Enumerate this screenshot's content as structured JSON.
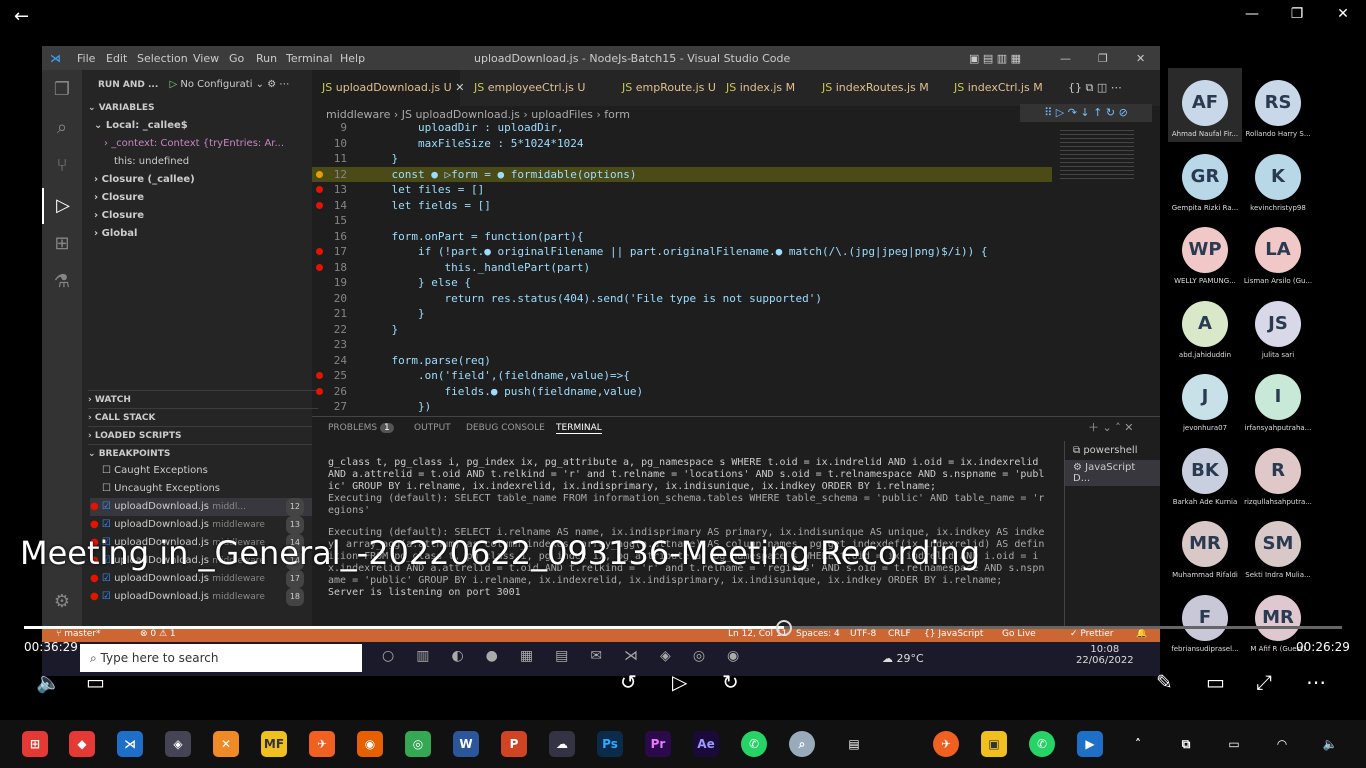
{
  "window": {
    "title": "uploadDownload.js - NodeJs-Batch15 - Visual Studio Code",
    "menus": [
      "File",
      "Edit",
      "Selection",
      "View",
      "Go",
      "Run",
      "Terminal",
      "Help"
    ]
  },
  "sidebar": {
    "run_label": "RUN AND ...",
    "config": "No Configurati",
    "variables": "VARIABLES",
    "local": "Local: _callee$",
    "context": "_context: Context {tryEntries: Ar...",
    "this": "this: undefined",
    "closure1": "Closure (_callee)",
    "closure2": "Closure",
    "closure3": "Closure",
    "global": "Global",
    "watch": "WATCH",
    "callstack": "CALL STACK",
    "loaded": "LOADED SCRIPTS",
    "breakpoints": "BREAKPOINTS",
    "caught": "Caught Exceptions",
    "uncaught": "Uncaught Exceptions",
    "bps": [
      {
        "file": "uploadDownload.js",
        "dir": "middl...",
        "line": "12"
      },
      {
        "file": "uploadDownload.js",
        "dir": "middleware",
        "line": "13"
      },
      {
        "file": "uploadDownload.js",
        "dir": "middleware",
        "line": "14"
      },
      {
        "file": "uploadDownload.js",
        "dir": "middleware",
        "line": "14"
      },
      {
        "file": "uploadDownload.js",
        "dir": "middleware",
        "line": "17"
      },
      {
        "file": "uploadDownload.js",
        "dir": "middleware",
        "line": "18"
      }
    ]
  },
  "tabs": [
    {
      "name": "uploadDownload.js",
      "mark": "U"
    },
    {
      "name": "employeeCtrl.js",
      "mark": "U"
    },
    {
      "name": "empRoute.js",
      "mark": "U"
    },
    {
      "name": "index.js",
      "mark": "M"
    },
    {
      "name": "indexRoutes.js",
      "mark": "M"
    },
    {
      "name": "indexCtrl.js",
      "mark": "M"
    }
  ],
  "crumbs": "middleware  ›  JS uploadDownload.js  ›  uploadFiles  ›  form",
  "code": [
    {
      "n": "9",
      "t": "        uploadDir : uploadDir,"
    },
    {
      "n": "10",
      "t": "        maxFileSize : 5*1024*1024"
    },
    {
      "n": "11",
      "t": "    }"
    },
    {
      "n": "12",
      "t": "    const ● ▷form = ● formidable(options)"
    },
    {
      "n": "13",
      "t": "    let files = []"
    },
    {
      "n": "14",
      "t": "    let fields = []"
    },
    {
      "n": "15",
      "t": ""
    },
    {
      "n": "16",
      "t": "    form.onPart = function(part){"
    },
    {
      "n": "17",
      "t": "        if (!part.● originalFilename || part.originalFilename.● match(/\\.(jpg|jpeg|png)$/i)) {"
    },
    {
      "n": "18",
      "t": "            this._handlePart(part)"
    },
    {
      "n": "19",
      "t": "        } else {"
    },
    {
      "n": "20",
      "t": "            return res.status(404).send('File type is not supported')"
    },
    {
      "n": "21",
      "t": "        }"
    },
    {
      "n": "22",
      "t": "    }"
    },
    {
      "n": "23",
      "t": ""
    },
    {
      "n": "24",
      "t": "    form.parse(req)"
    },
    {
      "n": "25",
      "t": "        .on('field',(fieldname,value)=>{"
    },
    {
      "n": "26",
      "t": "            fields.● push(fieldname,value)"
    },
    {
      "n": "27",
      "t": "        })"
    }
  ],
  "panel": {
    "problems": "PROBLEMS",
    "problems_count": "1",
    "output": "OUTPUT",
    "debug": "DEBUG CONSOLE",
    "terminal": "TERMINAL",
    "shell1": "powershell",
    "shell2": "JavaScript D...",
    "lines": [
      "g_class t, pg_class i, pg_index ix, pg_attribute a, pg_namespace s WHERE t.oid = ix.indrelid AND i.oid = ix.indexrelid AND a.attrelid = t.oid AND t.relkind = 'r' and t.relname = 'locations' AND s.oid = t.relnamespace AND s.nspname = 'public' GROUP BY i.relname, ix.indexrelid, ix.indisprimary, ix.indisunique, ix.indkey ORDER BY i.relname;",
      "Executing (default): SELECT table_name FROM information_schema.tables WHERE table_schema = 'public' AND table_name = 'regions'",
      "",
      "Executing (default): SELECT i.relname AS name, ix.indisprimary AS primary, ix.indisunique AS unique, ix.indkey AS indkey, array_agg(a.attnum) as column_indexes, array_agg(a.attname) AS column_names, pg_get_indexdef(ix.indexrelid) AS definition FROM pg_class t, pg_class i, pg_index ix, pg_attribute a, pg_namespace s WHERE t.oid = ix.indrelid AND i.oid = ix.indexrelid AND a.attrelid = t.oid AND t.relkind = 'r' and t.relname = 'regions' AND s.oid = t.relnamespace AND s.nspname = 'public' GROUP BY i.relname, ix.indexrelid, ix.indisprimary, ix.indisunique, ix.indkey ORDER BY i.relname;",
      "Server is listening on port 3001"
    ]
  },
  "status": {
    "branch": "master*",
    "errors": "⊗ 0 ⚠ 1",
    "pos": "Ln 12, Col 11",
    "spaces": "Spaces: 4",
    "enc": "UTF-8",
    "eol": "CRLF",
    "lang": "{} JavaScript",
    "live": "Go Live",
    "prettier": "✓ Prettier"
  },
  "inner_taskbar": {
    "search": "Type here to search",
    "weather": "29°C",
    "time": "10:08",
    "date": "22/06/2022"
  },
  "participants": [
    {
      "i": "AF",
      "n": "Ahmad Naufal Fir...",
      "c": "#c8d8e8"
    },
    {
      "i": "RS",
      "n": "Rollando Harry S...",
      "c": "#c8d8e8"
    },
    {
      "i": "GR",
      "n": "Gempita Rizki Ra...",
      "c": "#b8d8e8"
    },
    {
      "i": "K",
      "n": "kevinchristyp98",
      "c": "#b8d8e8"
    },
    {
      "i": "WP",
      "n": "WELLY PAMUNG...",
      "c": "#f0c8c8"
    },
    {
      "i": "LA",
      "n": "Lisman Arsilo (Gu...",
      "c": "#f0c8c8"
    },
    {
      "i": "A",
      "n": "abd.jahiduddin",
      "c": "#d8e8c8"
    },
    {
      "i": "JS",
      "n": "julita sari",
      "c": "#d8d8e8"
    },
    {
      "i": "J",
      "n": "jevonhura07",
      "c": "#c8e0e8"
    },
    {
      "i": "I",
      "n": "irfansyahputraha...",
      "c": "#c8e8d8"
    },
    {
      "i": "BK",
      "n": "Barkah Ade Kurnia",
      "c": "#c8d0e0"
    },
    {
      "i": "R",
      "n": "rizqullahsahputra...",
      "c": "#e0c8c8"
    },
    {
      "i": "MR",
      "n": "Muhammad Rifaldi",
      "c": "#d8c8c8"
    },
    {
      "i": "SM",
      "n": "Sekti Indra Mulia...",
      "c": "#d8c8c8"
    },
    {
      "i": "F",
      "n": "febriansudiprasel...",
      "c": "#c8c8d8"
    },
    {
      "i": "MR",
      "n": "M Afif R (Guest)",
      "c": "#e0c8d0"
    }
  ],
  "recording": {
    "title": "Meeting in _General_-20220622_093136-Meeting Recording",
    "elapsed": "00:36:29",
    "remaining": "00:26:29",
    "progress": 0.577
  },
  "colors": {
    "accent": "#cc6633",
    "vscode_bg": "#1e1e1e"
  }
}
